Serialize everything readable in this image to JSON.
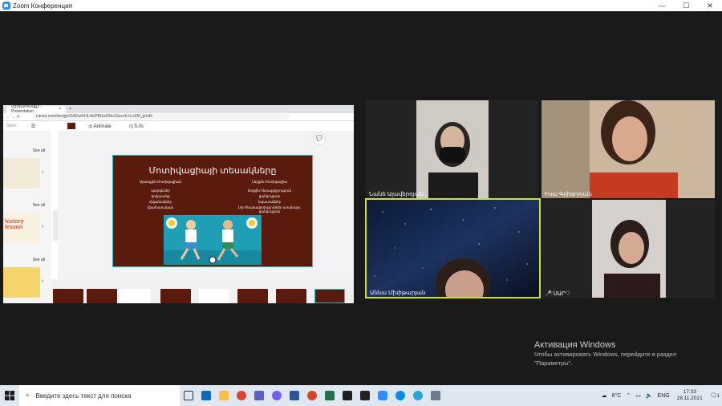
{
  "window": {
    "title": "Zoom Конференция",
    "minimize": "—",
    "maximize": "☐",
    "close": "✕"
  },
  "shared_screen": {
    "tab_title": "Աշխատանք3 - Presentation",
    "tab_close": "×",
    "new_tab": "+",
    "url": "canva.com/design/DAEwrhfJL4k/PfNnzDNoJSsvoh-U-x0M_g/edit",
    "left_panel_label": "lates",
    "animate_label": "Animate",
    "duration": "5.0s",
    "see_all": "See all",
    "thumb_text_1": "history lesson",
    "slide": {
      "title": "Մոտիվացիայի տեսակները",
      "col1_header": "Արտաքին Մոտիվացիան",
      "col1_items": [
        "պարգևներ",
        "գովասանք",
        "մրցանակներ",
        "գնահատական"
      ],
      "col2_header": "Ներքին Մոտիվացիա",
      "col2_items": [
        "ներքին հետաքրքրություն",
        "ցանկություն",
        "նպատակներ",
        "նոր հնարավորություններ ստանալու ցանկություն"
      ]
    }
  },
  "participants": [
    {
      "name": "Նանե Ալավերդյան"
    },
    {
      "name": "Իսա Գրիգորյան"
    },
    {
      "name": "Աննա Մխիթարյան"
    },
    {
      "name": "ՍԱՐ♡"
    }
  ],
  "activation": {
    "heading": "Активация Windows",
    "line1": "Чтобы активировать Windows, перейдите в раздел",
    "line2": "\"Параметры\"."
  },
  "taskbar": {
    "search_placeholder": "Введите здесь текст для поиска",
    "weather": "6°C",
    "language": "ENG",
    "time": "17:33",
    "date": "28.11.2021",
    "notifications": "1"
  },
  "colors": {
    "zoom_blue": "#2d8cff",
    "slide_bg": "#5a1a0c",
    "active_speaker": "#c8e23a",
    "taskbar": "#dfe8f1"
  }
}
